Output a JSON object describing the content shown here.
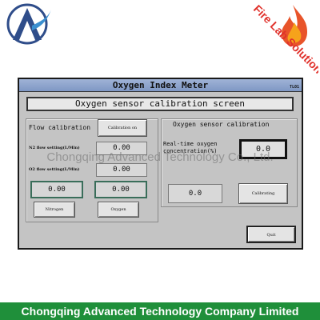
{
  "brand": {
    "logo_icon": "a-logo-icon",
    "fire_logo_text": "Fire Lab Solution",
    "fire_icon": "flame-icon"
  },
  "window": {
    "title": "Oxygen Index Meter",
    "code": "TL01",
    "screen_title": "Oxygen sensor calibration screen"
  },
  "flow": {
    "heading": "Flow calibration",
    "calibration_on_label": "Calibration on",
    "n2_label": "N2 flow setting(L/Min)",
    "n2_value": "0.00",
    "o2_label": "O2 flow setting(L/Min)",
    "o2_value": "0.00",
    "n2_actual": "0.00",
    "o2_actual": "0.00",
    "nitrogen_label": "Nitrogen",
    "oxygen_label": "Oxygen"
  },
  "sensor": {
    "heading": "Oxygen sensor calibration",
    "realtime_label_line1": "Real-time oxygen",
    "realtime_label_line2": "concentration(%)",
    "realtime_value": "0.0",
    "calib_value": "0.0",
    "calibrating_label": "Calibrating"
  },
  "quit_label": "Quit",
  "watermark": "Chongqing Advanced Technology Co., Ltd.",
  "footer": "Chongqing Advanced Technology Company Limited",
  "colors": {
    "footer_bg": "#1f8f3a",
    "titlebar": "#8fa6cf",
    "window_bg": "#c4c4c4"
  }
}
